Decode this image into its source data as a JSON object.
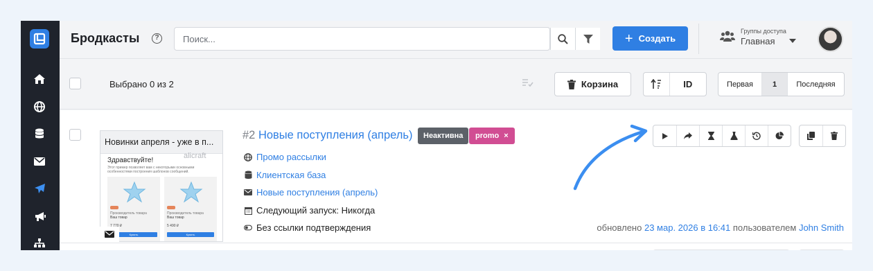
{
  "app": {
    "title": "Бродкасты",
    "help_icon": "?",
    "search_placeholder": "Поиск...",
    "create_label": "Создать",
    "groups_label": "Группы доступа",
    "groups_value": "Главная"
  },
  "sidebar": {
    "items": [
      "home-icon",
      "globe-icon",
      "database-icon",
      "envelope-icon",
      "send-icon",
      "megaphone-icon",
      "sitemap-icon"
    ],
    "active": "send-icon"
  },
  "toolbar": {
    "selected_text": "Выбрано 0 из 2",
    "trash_label": "Корзина",
    "sort_label": "ID",
    "pager_first": "Первая",
    "pager_current": "1",
    "pager_last": "Последняя"
  },
  "broadcast": {
    "number": "#2",
    "title": "Новые поступления (апрель)",
    "status_badge": "Неактивна",
    "tag": "promo",
    "tag_remove": "×",
    "thumbnail": {
      "header": "Новинки апреля - уже в п...",
      "greeting": "Здравствуйте!",
      "body": "Этот пример позволяет вам с некоторыми основными особенностями построения шаблонов сообщений.",
      "watermark": "alicraft",
      "product_maker": "Производитель товара",
      "product_name": "Ваш товар",
      "price_1": "7 770 ₽",
      "price_2": "5 490 ₽",
      "buy_label": "Купить"
    },
    "meta": {
      "channel": "Промо рассылки",
      "audience": "Клиентская база",
      "message": "Новые поступления (апрель)",
      "next_run": "Следующий запуск: Никогда",
      "confirmation": "Без ссылки подтверждения"
    },
    "updated_prefix": "обновлено",
    "updated_date": "23 мар. 2026 в 16:41",
    "updated_by_prefix": "пользователем",
    "updated_user": "John Smith",
    "actions": [
      "play-icon",
      "share-icon",
      "hourglass-icon",
      "flask-icon",
      "history-icon",
      "pie-chart-icon"
    ],
    "secondary_actions": [
      "copy-icon",
      "trash-icon"
    ]
  },
  "colors": {
    "accent": "#2f7fe3",
    "sidebar": "#1f232c",
    "badge_inactive": "#5c6168",
    "badge_promo": "#d14d93"
  }
}
